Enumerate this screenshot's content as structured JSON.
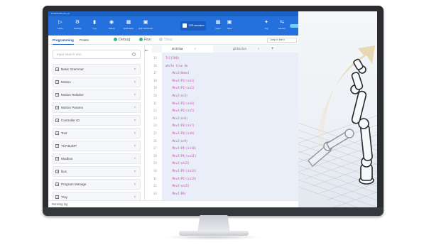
{
  "app": {
    "title": "DobotStudio Pro v2",
    "ribbon": [
      {
        "label": "Close",
        "icon": "close-connection-icon"
      },
      {
        "label": "Settings",
        "icon": "gear-icon"
      },
      {
        "label": "Log",
        "icon": "log-icon"
      },
      {
        "label": "Teleop",
        "icon": "teleop-icon"
      },
      {
        "label": "Application",
        "icon": "application-icon"
      },
      {
        "label": "Help document",
        "icon": "help-icon"
      }
    ],
    "sim_button": "CR5 simulation",
    "ribbon_right": [
      {
        "label": "Open",
        "icon": "folder-icon"
      },
      {
        "label": "Save",
        "icon": "save-icon"
      },
      {
        "label": "Jog",
        "icon": "jog-icon"
      },
      {
        "label": "Monitor",
        "icon": "monitor-icon"
      }
    ]
  },
  "toolbar": {
    "tabs": [
      "Programming",
      "Points"
    ],
    "debug_label": "Debug",
    "run_label": "Run",
    "stop_label": "Stop",
    "jump_placeholder": "Jump to line n"
  },
  "sidebar": {
    "search_placeholder": "Input search text",
    "groups": [
      "Basic Grammar",
      "Motion",
      "Motion Relative",
      "Motion Params",
      "Controller IO",
      "Tool",
      "TCP&UDP",
      "Modbus",
      "Bus",
      "Program Manage",
      "Tray"
    ],
    "help_glyph": "?"
  },
  "editor": {
    "tabs": [
      {
        "label": "src0.lua",
        "active": true
      },
      {
        "label": "global.lua",
        "active": false
      }
    ],
    "add_tab": "+",
    "lines": [
      {
        "n": "15",
        "parts": [
          {
            "t": "Tcl(100)",
            "c": "fn"
          }
        ]
      },
      {
        "n": "16",
        "parts": [
          {
            "t": "while ",
            "c": "kw"
          },
          {
            "t": "true ",
            "c": "fn"
          },
          {
            "t": "do",
            "c": "kw"
          }
        ]
      },
      {
        "n": "17",
        "parts": [
          {
            "t": "    MovJ(Home)",
            "c": "fn"
          }
        ]
      },
      {
        "n": "18",
        "parts": [
          {
            "t": "    MovJ(P1)(sn1)",
            "c": "fn"
          }
        ]
      },
      {
        "n": "19",
        "parts": [
          {
            "t": "    MovJ(P1)(sn2)",
            "c": "fn"
          }
        ]
      },
      {
        "n": "20",
        "parts": [
          {
            "t": "    MovJ(sn3)",
            "c": "fn"
          }
        ]
      },
      {
        "n": "21",
        "parts": [
          {
            "t": "    MovJ(P2)(sn4)",
            "c": "fn"
          }
        ]
      },
      {
        "n": "22",
        "parts": [
          {
            "t": "    MovJ(P2)(sn5)",
            "c": "fn"
          }
        ]
      },
      {
        "n": "23",
        "parts": [
          {
            "t": "    MovJ(sn6)",
            "c": "fn"
          }
        ]
      },
      {
        "n": "24",
        "parts": [
          {
            "t": "    MovJ(P3)(sn7)",
            "c": "fn"
          }
        ]
      },
      {
        "n": "25",
        "parts": [
          {
            "t": "    MovJ(P3)(sn8)",
            "c": "fn"
          }
        ]
      },
      {
        "n": "26",
        "parts": [
          {
            "t": "    MovJ(sn9)",
            "c": "fn"
          }
        ]
      },
      {
        "n": "27",
        "parts": [
          {
            "t": "    MovJ(P4)(sn10)",
            "c": "fn"
          }
        ]
      },
      {
        "n": "28",
        "parts": [
          {
            "t": "    MovJ(P4)(sn11)",
            "c": "fn"
          }
        ]
      },
      {
        "n": "29",
        "parts": [
          {
            "t": "    MovJ(sn12)",
            "c": "fn"
          }
        ]
      },
      {
        "n": "30",
        "parts": [
          {
            "t": "    MovJ(P5)(sn13)",
            "c": "fn"
          }
        ]
      },
      {
        "n": "31",
        "parts": [
          {
            "t": "    MovJ(P5)(sn14)",
            "c": "fn"
          }
        ]
      },
      {
        "n": "32",
        "parts": [
          {
            "t": "    MovJ(sn15)",
            "c": "fn"
          }
        ]
      },
      {
        "n": "33",
        "parts": [
          {
            "t": "    MovJ(P6)",
            "c": "fn"
          }
        ]
      }
    ]
  },
  "status": {
    "text": "Running log"
  },
  "colors": {
    "ribbon": "#2470dc",
    "title_bar": "#1b62c6",
    "debug_dot": "#36b37e",
    "run_dot": "#36b37e",
    "code_bg": "#e9eef8"
  }
}
